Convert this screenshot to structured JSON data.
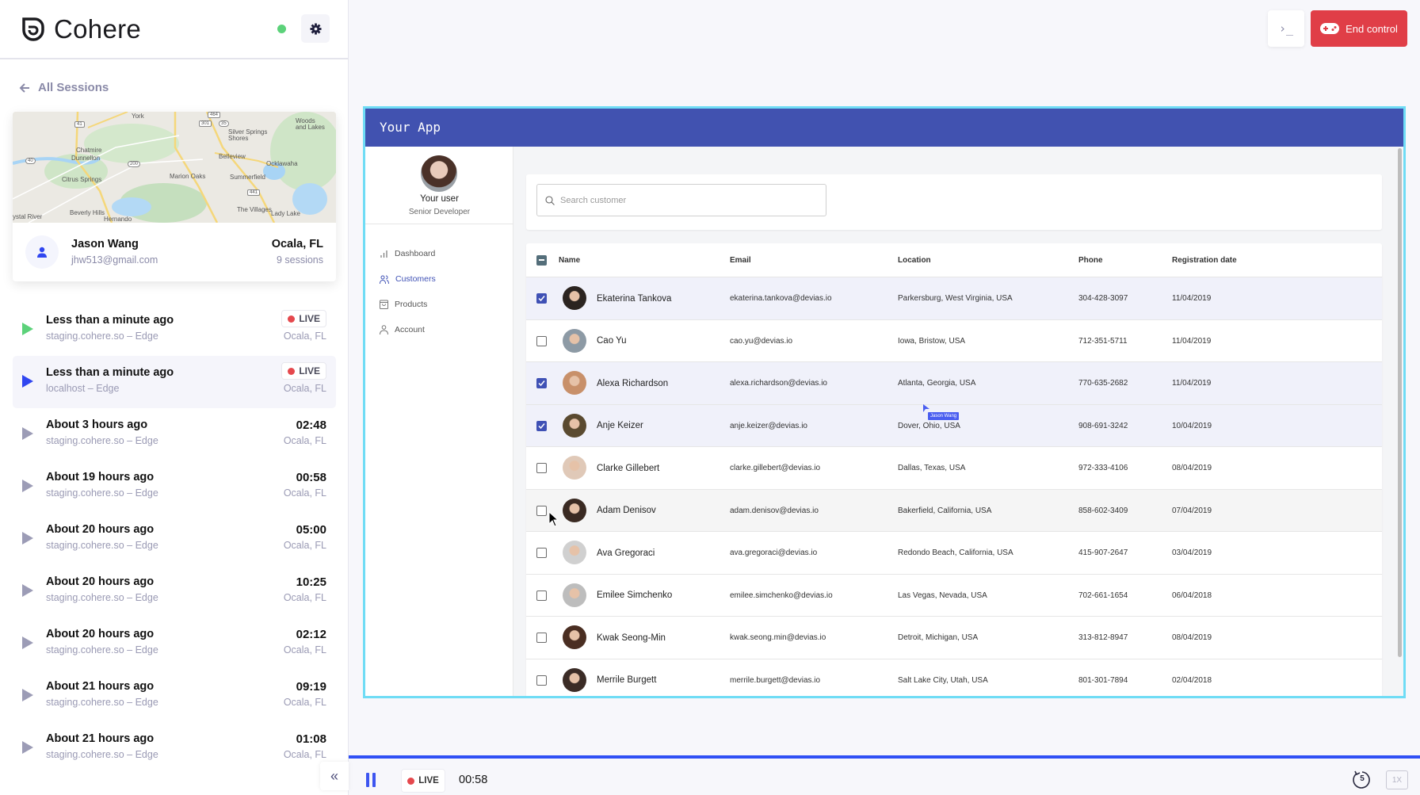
{
  "brand": {
    "name": "Cohere",
    "status_color": "#5cd27a",
    "accent": "#3050f5"
  },
  "sidebar": {
    "back_label": "All Sessions",
    "map_labels": [
      "York",
      "Woods and Lakes",
      "Silver Springs Shores",
      "Chatmire",
      "Dunnellon",
      "Belleview",
      "Ocklawaha",
      "Citrus Springs",
      "Marion Oaks",
      "Summerfield",
      "Beverly Hills",
      "Hernando",
      "The Villages",
      "Lady Lake",
      "ystal River",
      "41",
      "40",
      "200",
      "301",
      "35",
      "464",
      "441"
    ],
    "user": {
      "name": "Jason Wang",
      "email": "jhw513@gmail.com",
      "city": "Ocala, FL",
      "sessions": "9 sessions"
    },
    "live_label": "LIVE",
    "sessions": [
      {
        "title": "Less than a minute ago",
        "source": "staging.cohere.so – Edge",
        "duration": "",
        "live": true,
        "location": "Ocala, FL",
        "play_color": "#5cd27a"
      },
      {
        "title": "Less than a minute ago",
        "source": "localhost – Edge",
        "duration": "",
        "live": true,
        "location": "Ocala, FL",
        "play_color": "#3046f0",
        "selected": true
      },
      {
        "title": "About 3 hours ago",
        "source": "staging.cohere.so – Edge",
        "duration": "02:48",
        "location": "Ocala, FL"
      },
      {
        "title": "About 19 hours ago",
        "source": "staging.cohere.so – Edge",
        "duration": "00:58",
        "location": "Ocala, FL"
      },
      {
        "title": "About 20 hours ago",
        "source": "staging.cohere.so – Edge",
        "duration": "05:00",
        "location": "Ocala, FL"
      },
      {
        "title": "About 20 hours ago",
        "source": "staging.cohere.so – Edge",
        "duration": "10:25",
        "location": "Ocala, FL"
      },
      {
        "title": "About 20 hours ago",
        "source": "staging.cohere.so – Edge",
        "duration": "02:12",
        "location": "Ocala, FL"
      },
      {
        "title": "About 21 hours ago",
        "source": "staging.cohere.so – Edge",
        "duration": "09:19",
        "location": "Ocala, FL"
      },
      {
        "title": "About 21 hours ago",
        "source": "staging.cohere.so – Edge",
        "duration": "01:08",
        "location": "Ocala, FL"
      }
    ],
    "collapse_icon": "«"
  },
  "toolbar": {
    "terminal_icon": "›_",
    "end_control_label": "End control",
    "end_control_color": "#e03e47"
  },
  "app": {
    "title": "Your App",
    "header_color": "#4152b0",
    "profile": {
      "name": "Your user",
      "role": "Senior Developer"
    },
    "nav": [
      {
        "label": "Dashboard",
        "icon": "bar-chart-icon"
      },
      {
        "label": "Customers",
        "icon": "users-icon",
        "active": true
      },
      {
        "label": "Products",
        "icon": "shopping-bag-icon"
      },
      {
        "label": "Account",
        "icon": "user-icon"
      }
    ],
    "search_placeholder": "Search customer",
    "table": {
      "columns": [
        "Name",
        "Email",
        "Location",
        "Phone",
        "Registration date"
      ],
      "rows": [
        {
          "name": "Ekaterina Tankova",
          "email": "ekaterina.tankova@devias.io",
          "location": "Parkersburg, West Virginia, USA",
          "phone": "304-428-3097",
          "date": "11/04/2019",
          "checked": true
        },
        {
          "name": "Cao Yu",
          "email": "cao.yu@devias.io",
          "location": "Iowa, Bristow, USA",
          "phone": "712-351-5711",
          "date": "11/04/2019",
          "checked": false
        },
        {
          "name": "Alexa Richardson",
          "email": "alexa.richardson@devias.io",
          "location": "Atlanta, Georgia, USA",
          "phone": "770-635-2682",
          "date": "11/04/2019",
          "checked": true
        },
        {
          "name": "Anje Keizer",
          "email": "anje.keizer@devias.io",
          "location": "Dover, Ohio, USA",
          "phone": "908-691-3242",
          "date": "10/04/2019",
          "checked": true
        },
        {
          "name": "Clarke Gillebert",
          "email": "clarke.gillebert@devias.io",
          "location": "Dallas, Texas, USA",
          "phone": "972-333-4106",
          "date": "08/04/2019",
          "checked": false
        },
        {
          "name": "Adam Denisov",
          "email": "adam.denisov@devias.io",
          "location": "Bakerfield, California, USA",
          "phone": "858-602-3409",
          "date": "07/04/2019",
          "checked": false,
          "hover": true
        },
        {
          "name": "Ava Gregoraci",
          "email": "ava.gregoraci@devias.io",
          "location": "Redondo Beach, California, USA",
          "phone": "415-907-2647",
          "date": "03/04/2019",
          "checked": false
        },
        {
          "name": "Emilee Simchenko",
          "email": "emilee.simchenko@devias.io",
          "location": "Las Vegas, Nevada, USA",
          "phone": "702-661-1654",
          "date": "06/04/2018",
          "checked": false
        },
        {
          "name": "Kwak Seong-Min",
          "email": "kwak.seong.min@devias.io",
          "location": "Detroit, Michigan, USA",
          "phone": "313-812-8947",
          "date": "08/04/2019",
          "checked": false
        },
        {
          "name": "Merrile Burgett",
          "email": "merrile.burgett@devias.io",
          "location": "Salt Lake City, Utah, USA",
          "phone": "801-301-7894",
          "date": "02/04/2018",
          "checked": false
        }
      ]
    },
    "remote_cursor_label": "Jason Wang"
  },
  "player": {
    "live_label": "LIVE",
    "time": "00:58",
    "rewind_seconds": "5",
    "speed": "1X",
    "progress_percent": 100
  }
}
